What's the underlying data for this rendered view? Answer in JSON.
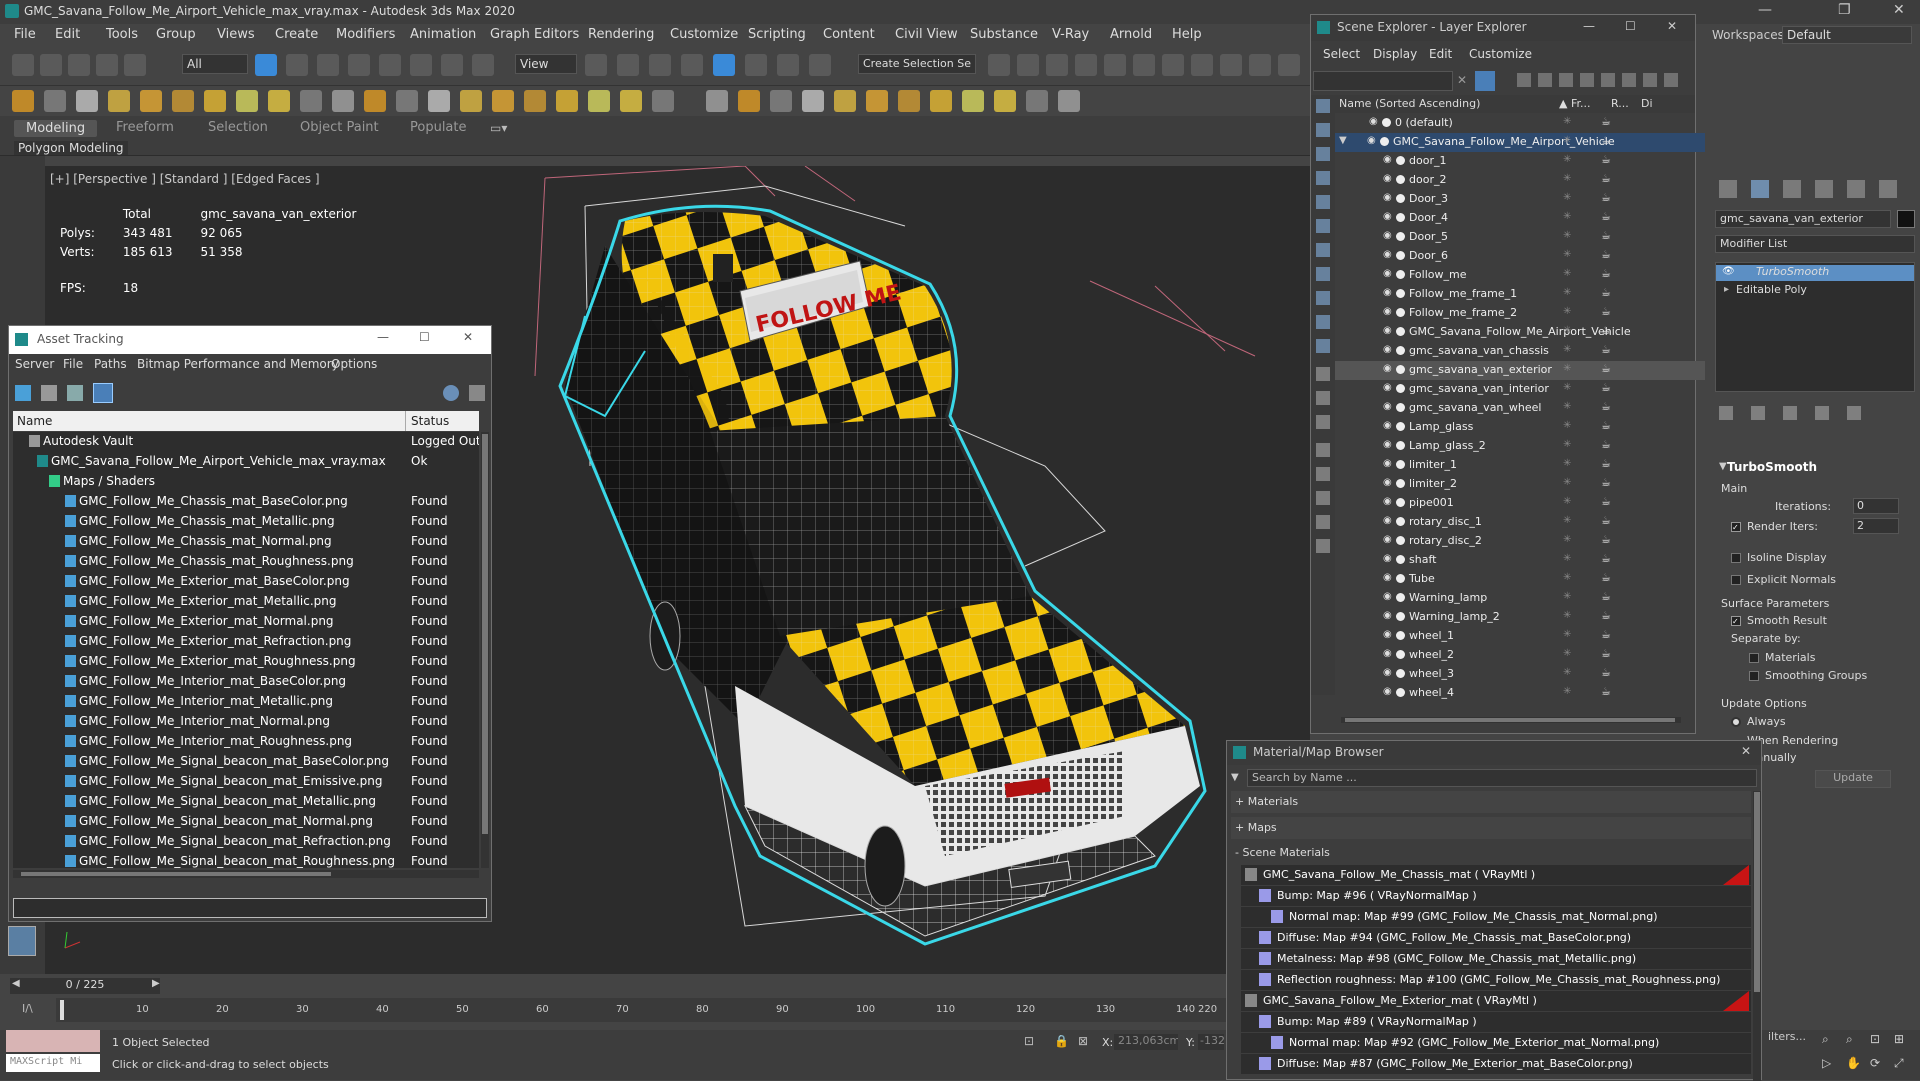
{
  "window_title": "GMC_Savana_Follow_Me_Airport_Vehicle_max_vray.max - Autodesk 3ds Max 2020",
  "workspace": {
    "label": "Workspaces:",
    "value": "Default"
  },
  "menu": [
    "File",
    "Edit",
    "Tools",
    "Group",
    "Views",
    "Create",
    "Modifiers",
    "Animation",
    "Graph Editors",
    "Rendering",
    "Customize",
    "Scripting",
    "Content",
    "Civil View",
    "Substance",
    "V-Ray",
    "Arnold",
    "Help"
  ],
  "toolbar": {
    "selection_filter": "All",
    "view_dropdown": "View",
    "selection_set": "Create Selection Se"
  },
  "ribbon": {
    "tabs": [
      "Modeling",
      "Freeform",
      "Selection",
      "Object Paint",
      "Populate"
    ],
    "sub": "Polygon Modeling"
  },
  "viewport": {
    "label": "[+] [Perspective ] [Standard ] [Edged Faces ]",
    "stats": {
      "total_label": "Total",
      "object": "gmc_savana_van_exterior",
      "polys_label": "Polys:",
      "polys_total": "343 481",
      "polys_obj": "92 065",
      "verts_label": "Verts:",
      "verts_total": "185 613",
      "verts_obj": "51 358",
      "fps_label": "FPS:",
      "fps": "18"
    },
    "sign_text": "FOLLOW ME"
  },
  "asset_tracking": {
    "title": "Asset Tracking",
    "menu": [
      "Server",
      "File",
      "Paths",
      "Bitmap Performance and Memory",
      "Options"
    ],
    "col_name": "Name",
    "col_status": "Status",
    "rows": [
      {
        "name": "Autodesk Vault",
        "status": "Logged Out"
      },
      {
        "name": "GMC_Savana_Follow_Me_Airport_Vehicle_max_vray.max",
        "status": "Ok"
      },
      {
        "name": "Maps / Shaders",
        "status": ""
      },
      {
        "name": "GMC_Follow_Me_Chassis_mat_BaseColor.png",
        "status": "Found"
      },
      {
        "name": "GMC_Follow_Me_Chassis_mat_Metallic.png",
        "status": "Found"
      },
      {
        "name": "GMC_Follow_Me_Chassis_mat_Normal.png",
        "status": "Found"
      },
      {
        "name": "GMC_Follow_Me_Chassis_mat_Roughness.png",
        "status": "Found"
      },
      {
        "name": "GMC_Follow_Me_Exterior_mat_BaseColor.png",
        "status": "Found"
      },
      {
        "name": "GMC_Follow_Me_Exterior_mat_Metallic.png",
        "status": "Found"
      },
      {
        "name": "GMC_Follow_Me_Exterior_mat_Normal.png",
        "status": "Found"
      },
      {
        "name": "GMC_Follow_Me_Exterior_mat_Refraction.png",
        "status": "Found"
      },
      {
        "name": "GMC_Follow_Me_Exterior_mat_Roughness.png",
        "status": "Found"
      },
      {
        "name": "GMC_Follow_Me_Interior_mat_BaseColor.png",
        "status": "Found"
      },
      {
        "name": "GMC_Follow_Me_Interior_mat_Metallic.png",
        "status": "Found"
      },
      {
        "name": "GMC_Follow_Me_Interior_mat_Normal.png",
        "status": "Found"
      },
      {
        "name": "GMC_Follow_Me_Interior_mat_Roughness.png",
        "status": "Found"
      },
      {
        "name": "GMC_Follow_Me_Signal_beacon_mat_BaseColor.png",
        "status": "Found"
      },
      {
        "name": "GMC_Follow_Me_Signal_beacon_mat_Emissive.png",
        "status": "Found"
      },
      {
        "name": "GMC_Follow_Me_Signal_beacon_mat_Metallic.png",
        "status": "Found"
      },
      {
        "name": "GMC_Follow_Me_Signal_beacon_mat_Normal.png",
        "status": "Found"
      },
      {
        "name": "GMC_Follow_Me_Signal_beacon_mat_Refraction.png",
        "status": "Found"
      },
      {
        "name": "GMC_Follow_Me_Signal_beacon_mat_Roughness.png",
        "status": "Found"
      }
    ]
  },
  "scene_explorer": {
    "title": "Scene Explorer - Layer Explorer",
    "menu": [
      "Select",
      "Display",
      "Edit",
      "Customize"
    ],
    "col_name": "Name (Sorted Ascending)",
    "col_fr": "▲ Fr...",
    "col_r": "R...",
    "col_d": "Di",
    "layer_default": "0 (default)",
    "layer_main": "GMC_Savana_Follow_Me_Airport_Vehicle",
    "objects": [
      "door_1",
      "door_2",
      "Door_3",
      "Door_4",
      "Door_5",
      "Door_6",
      "Follow_me",
      "Follow_me_frame_1",
      "Follow_me_frame_2",
      "GMC_Savana_Follow_Me_Airport_Vehicle",
      "gmc_savana_van_chassis",
      "gmc_savana_van_exterior",
      "gmc_savana_van_interior",
      "gmc_savana_van_wheel",
      "Lamp_glass",
      "Lamp_glass_2",
      "limiter_1",
      "limiter_2",
      "pipe001",
      "rotary_disc_1",
      "rotary_disc_2",
      "shaft",
      "Tube",
      "Warning_lamp",
      "Warning_lamp_2",
      "wheel_1",
      "wheel_2",
      "wheel_3",
      "wheel_4"
    ],
    "selected": "gmc_savana_van_exterior"
  },
  "command_panel": {
    "object_name": "gmc_savana_van_exterior",
    "modifier_list": "Modifier List",
    "stack": [
      "TurboSmooth",
      "Editable Poly"
    ],
    "rollout": "TurboSmooth",
    "main": "Main",
    "iterations_label": "Iterations:",
    "iterations": "0",
    "render_iters_label": "Render Iters:",
    "render_iters": "2",
    "isoline": "Isoline Display",
    "explicit_normals": "Explicit Normals",
    "surface_params": "Surface Parameters",
    "smooth_result": "Smooth Result",
    "separate_by": "Separate by:",
    "materials": "Materials",
    "smoothing_groups": "Smoothing Groups",
    "update_options": "Update Options",
    "always": "Always",
    "when_rendering": "When Rendering",
    "manually": "Manually",
    "update_btn": "Update"
  },
  "material_browser": {
    "title": "Material/Map Browser",
    "search_placeholder": "Search by Name ...",
    "sections": [
      "+ Materials",
      "+ Maps",
      "- Scene Materials"
    ],
    "rows": [
      "GMC_Savana_Follow_Me_Chassis_mat ( VRayMtl )",
      "Bump: Map #96 ( VRayNormalMap )",
      "Normal map: Map #99 (GMC_Follow_Me_Chassis_mat_Normal.png)",
      "Diffuse: Map #94 (GMC_Follow_Me_Chassis_mat_BaseColor.png)",
      "Metalness: Map #98 (GMC_Follow_Me_Chassis_mat_Metallic.png)",
      "Reflection roughness: Map #100 (GMC_Follow_Me_Chassis_mat_Roughness.png)",
      "GMC_Savana_Follow_Me_Exterior_mat ( VRayMtl )",
      "Bump: Map #89 ( VRayNormalMap )",
      "Normal map: Map #92 (GMC_Follow_Me_Exterior_mat_Normal.png)",
      "Diffuse: Map #87 (GMC_Follow_Me_Exterior_mat_BaseColor.png)"
    ]
  },
  "timeline": {
    "frame": "0 / 225",
    "ticks": [
      "10",
      "20",
      "30",
      "40",
      "50",
      "60",
      "70",
      "80",
      "90",
      "100",
      "110",
      "120",
      "130",
      "140"
    ],
    "tick_end": "220"
  },
  "status": {
    "selected": "1 Object Selected",
    "hint": "Click or click-and-drag to select objects",
    "maxscript": "MAXScript Mi",
    "x_label": "X:",
    "x_val": "213,063cm",
    "y_label": "Y:",
    "y_val": "-132"
  },
  "colors": {
    "accent": "#3a8ad8",
    "selection": "#5c8fc4",
    "checker_yellow": "#f2c40c",
    "wire_cyan": "#3ad8e8"
  }
}
